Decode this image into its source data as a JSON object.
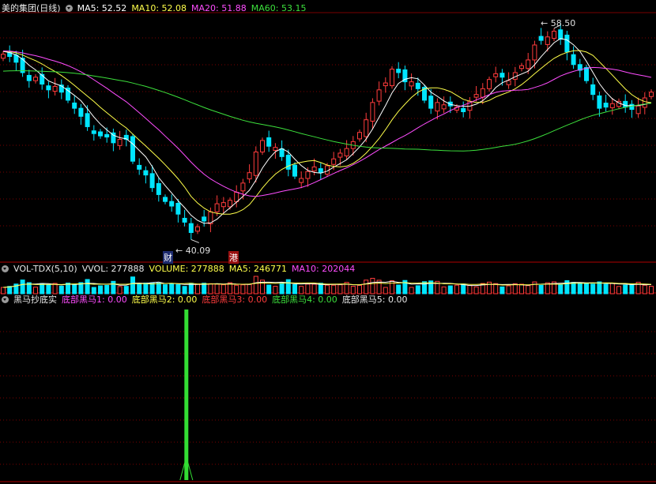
{
  "colors": {
    "up": "#ff3c3c",
    "down": "#00e5ff",
    "ma5": "#ffffff",
    "ma10": "#ffff4a",
    "ma20": "#ff4dff",
    "ma60": "#3ce03c",
    "grid": "#7a0000",
    "volma5": "#ffffff",
    "volma10": "#ffff4a",
    "signal": "#33dd33"
  },
  "main_panel": {
    "title": "美的集团(日线)",
    "ma5_label": "MA5: 52.52",
    "ma10_label": "MA10: 52.08",
    "ma20_label": "MA20: 51.88",
    "ma60_label": "MA60: 53.15",
    "high_label": "58.50",
    "low_label": "40.09",
    "marker_cai": "财",
    "marker_gang": "港",
    "menu_icon": "circle-chevron-down-icon"
  },
  "vol_panel": {
    "title": "VOL-TDX(5,10)",
    "vvol_label": "VVOL: 277888",
    "volume_label": "VOLUME: 277888",
    "ma5_label": "MA5: 246771",
    "ma10_label": "MA10: 202044"
  },
  "ind_panel": {
    "title": "黑马抄底实",
    "l1": "底部黑马1: 0.00",
    "l2": "底部黑马2: 0.00",
    "l3": "底部黑马3: 0.00",
    "l4": "底部黑马4: 0.00",
    "l5": "底部黑马5: 0.00"
  },
  "chart_data": [
    {
      "type": "candlestick",
      "title": "美的集团(日线)",
      "y_range": [
        40.09,
        58.5
      ],
      "annotations": [
        {
          "text": "58.50",
          "kind": "high"
        },
        {
          "text": "40.09",
          "kind": "low"
        }
      ],
      "legend": [
        "MA5: 52.52",
        "MA10: 52.08",
        "MA20: 51.88",
        "MA60: 53.15"
      ],
      "closes": [
        56.0,
        55.8,
        55.3,
        54.4,
        53.7,
        54.0,
        53.4,
        52.9,
        53.2,
        52.7,
        52.0,
        51.3,
        50.6,
        49.7,
        49.1,
        48.9,
        48.8,
        48.3,
        48.6,
        48.6,
        46.7,
        46.0,
        45.5,
        44.4,
        43.8,
        43.2,
        42.8,
        42.1,
        41.4,
        40.5,
        41.0,
        41.5,
        42.3,
        43.0,
        43.1,
        43.3,
        44.0,
        44.8,
        45.7,
        47.5,
        48.5,
        48.0,
        47.9,
        47.1,
        46.0,
        45.4,
        45.2,
        45.8,
        46.2,
        45.7,
        46.3,
        46.9,
        47.4,
        47.8,
        48.4,
        49.2,
        50.3,
        51.8,
        52.9,
        53.5,
        54.7,
        54.4,
        53.6,
        53.6,
        53.0,
        52.0,
        51.3,
        51.8,
        51.6,
        51.5,
        51.4,
        51.0,
        51.9,
        52.5,
        53.0,
        53.8,
        54.3,
        54.0,
        53.7,
        54.4,
        55.0,
        55.5,
        56.8,
        57.2,
        57.5,
        58.0,
        57.3,
        56.2,
        55.1,
        54.6,
        53.7,
        52.5,
        51.3,
        51.4,
        51.7,
        51.9,
        51.4,
        51.2,
        51.5,
        52.2,
        52.7
      ]
    },
    {
      "type": "bar",
      "title": "VOL-TDX(5,10)",
      "legend": [
        "VVOL: 277888",
        "VOLUME: 277888",
        "MA5: 246771",
        "MA10: 202044"
      ],
      "last_volume": 277888,
      "ma5": 246771,
      "ma10": 202044
    },
    {
      "type": "bar",
      "title": "黑马抄底实",
      "legend": [
        "底部黑马1: 0.00",
        "底部黑马2: 0.00",
        "底部黑马3: 0.00",
        "底部黑马4: 0.00",
        "底部黑马5: 0.00"
      ],
      "signal": {
        "bar_index": 29,
        "value": 1
      }
    }
  ]
}
